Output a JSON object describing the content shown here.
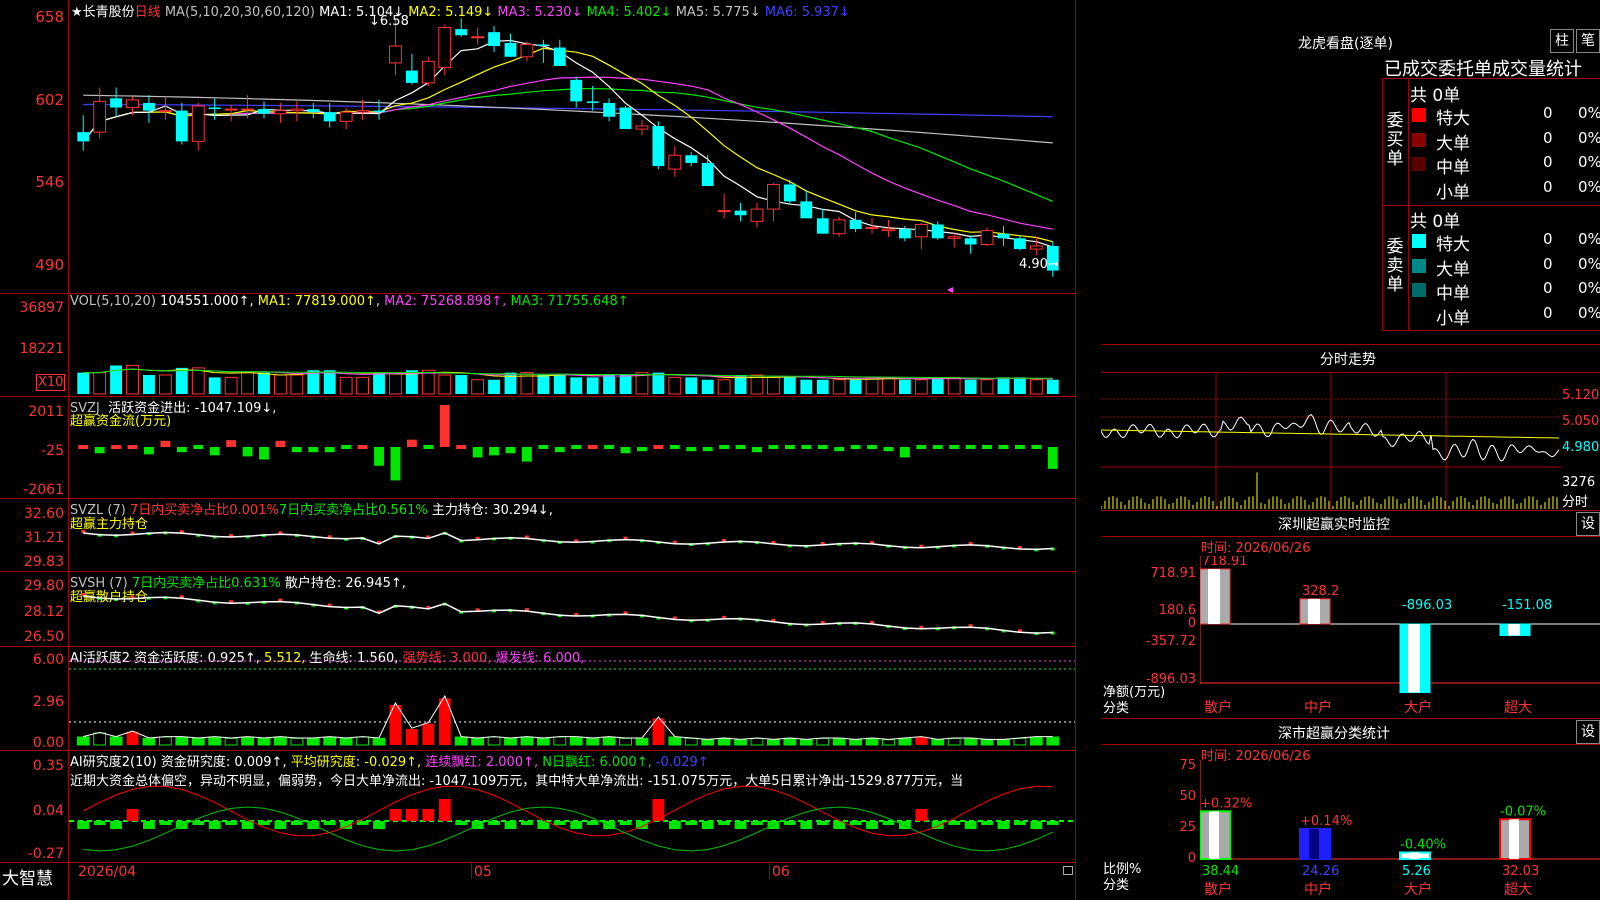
{
  "main": {
    "star": "★",
    "stock_name": "长青股份",
    "period": "日线",
    "ma_label": "MA(5,10,20,30,60,120)",
    "ma": [
      {
        "label": "MA1:",
        "value": "5.104↓",
        "color": "#ffffff"
      },
      {
        "label": "MA2:",
        "value": "5.149↓",
        "color": "#ffff00"
      },
      {
        "label": "MA3:",
        "value": "5.230↓",
        "color": "#ff40ff"
      },
      {
        "label": "MA4:",
        "value": "5.402↓",
        "color": "#00e600"
      },
      {
        "label": "MA5:",
        "value": "5.775↓",
        "color": "#c0c0c0"
      },
      {
        "label": "MA6:",
        "value": "5.937↓",
        "color": "#4040ff"
      }
    ],
    "y_ticks": [
      "658",
      "602",
      "546",
      "490"
    ],
    "high_label": "6.58",
    "low_label": "4.90",
    "colors": {
      "up": "#ff3232",
      "down": "#00ffff",
      "ma1": "#ffffff",
      "ma2": "#ffff00",
      "ma3": "#ff40ff",
      "ma4": "#00e600",
      "ma5": "#c0c0c0",
      "ma6": "#4040ff"
    }
  },
  "vol": {
    "label": "VOL(5,10,20)",
    "value": "104551.000↑,",
    "ma1": "MA1: 77819.000↑,",
    "ma2": "MA2: 75268.898↑,",
    "ma3": "MA3: 71755.648↑",
    "y_ticks": [
      "36897",
      "18221"
    ],
    "unit": "X10"
  },
  "svzj": {
    "name": "SVZJ",
    "text": "活跃资金进出: -1047.109↓,",
    "subtitle": "超赢资金流(万元)",
    "y_ticks": [
      "2011",
      "-25",
      "-2061"
    ]
  },
  "svzl": {
    "name": "SVZL (7)",
    "t1": "7日内买卖净占比0.001%",
    "t2": "7日内买卖净占比0.561%",
    "t3": "主力持仓: 30.294↓,",
    "subtitle": "超赢主力持仓",
    "y_ticks": [
      "32.60",
      "31.21",
      "29.83"
    ]
  },
  "svsh": {
    "name": "SVSH (7)",
    "t1": "7日内买卖净占比0.631%",
    "t2": "散户持仓: 26.945↑,",
    "subtitle": "超赢散户持仓",
    "y_ticks": [
      "29.80",
      "28.12",
      "26.50"
    ]
  },
  "ai_active": {
    "name": "AI活跃度2",
    "t1": "资金活跃度: 0.925↑,",
    "t2": "5.512,",
    "t3": "生命线: 1.560,",
    "t4": "强势线: 3.000,",
    "t5": "爆发线: 6.000,",
    "y_ticks": [
      "6.00",
      "2.96",
      "0.00"
    ]
  },
  "ai_research": {
    "name": "AI研究度2(10)",
    "t1": "资金研究度: 0.009↑,",
    "t2": "平均研究度: -0.029↑,",
    "t3": "连续飘红: 2.000↑,",
    "t4": "N日飘红: 6.000↑,",
    "t5": "-0.029↑",
    "commentary": "近期大资金总体偏空，异动不明显，偏弱势，今日大单净流出: -1047.109万元，其中特大单净流出: -151.075万元，大单5日累计净出-1529.877万元，当",
    "y_ticks": [
      "0.35",
      "0.04",
      "-0.27"
    ]
  },
  "x_axis": {
    "labels": [
      "2026/04",
      "05",
      "06"
    ]
  },
  "brand": "大智慧",
  "longhu": {
    "title": "龙虎看盘(逐单)",
    "btn1": "柱",
    "btn2": "笔",
    "stat_title": "已成交委托单成交量统计",
    "buy_label": "委买单",
    "sell_label": "委卖单",
    "buy_total": "共 0单",
    "sell_total": "共 0单",
    "buy_rows": [
      {
        "name": "特大",
        "count": "0",
        "pct": "0%",
        "color": "#ff0000"
      },
      {
        "name": "大单",
        "count": "0",
        "pct": "0%",
        "color": "#8b0000"
      },
      {
        "name": "中单",
        "count": "0",
        "pct": "0%",
        "color": "#5a0000"
      },
      {
        "name": "小单",
        "count": "0",
        "pct": "0%",
        "color": ""
      }
    ],
    "sell_rows": [
      {
        "name": "特大",
        "count": "0",
        "pct": "0%",
        "color": "#00ffff"
      },
      {
        "name": "大单",
        "count": "0",
        "pct": "0%",
        "color": "#008b8b"
      },
      {
        "name": "中单",
        "count": "0",
        "pct": "0%",
        "color": "#006b6b"
      },
      {
        "name": "小单",
        "count": "0",
        "pct": "0%",
        "color": ""
      }
    ]
  },
  "intraday": {
    "title": "分时走势",
    "y_ticks": [
      "5.120",
      "5.050",
      "4.980"
    ],
    "vol_tick": "3276",
    "vol_label": "分时"
  },
  "sz_monitor": {
    "title": "深圳超赢实时监控",
    "btn": "设",
    "time_label": "时间:",
    "time": "2026/06/26",
    "y_ticks": [
      "718.91",
      "180.6",
      "0",
      "-357.72",
      "-896.03"
    ],
    "ylabel": "净额(万元)",
    "xlabel": "分类",
    "categories": [
      "散户",
      "中户",
      "大户",
      "超大"
    ],
    "values": [
      718.91,
      328.2,
      -896.03,
      -151.08
    ],
    "value_labels": [
      "718.91",
      "328.2",
      "-896.03",
      "-151.08"
    ]
  },
  "sz_class": {
    "title": "深市超赢分类统计",
    "btn": "设",
    "time_label": "时间:",
    "time": "2026/06/26",
    "y_ticks": [
      "75",
      "50",
      "25",
      "0"
    ],
    "ylabel": "比例%",
    "xlabel": "分类",
    "categories": [
      "散户",
      "中户",
      "大户",
      "超大"
    ],
    "values": [
      38.44,
      24.26,
      5.26,
      32.03
    ],
    "value_labels": [
      "38.44",
      "24.26",
      "5.26",
      "32.03"
    ],
    "change_labels": [
      "+0.32%",
      "+0.14%",
      "-0.40%",
      "-0.07%"
    ]
  },
  "chart_data": [
    {
      "type": "candlestick",
      "title": "长青股份 日线",
      "ylim": [
        4.84,
        6.66
      ],
      "x_labels": [
        "2026/04",
        "05",
        "06"
      ],
      "ohlc": [
        [
          5.84,
          5.95,
          5.72,
          5.78
        ],
        [
          5.84,
          6.13,
          5.8,
          6.04
        ],
        [
          6.06,
          6.13,
          5.94,
          6.0
        ],
        [
          6.0,
          6.07,
          5.95,
          6.05
        ],
        [
          6.03,
          6.08,
          5.9,
          5.98
        ],
        [
          5.98,
          6.07,
          5.92,
          5.98
        ],
        [
          5.98,
          6.03,
          5.76,
          5.78
        ],
        [
          5.78,
          6.03,
          5.72,
          6.01
        ],
        [
          6.0,
          6.06,
          5.92,
          5.99
        ],
        [
          5.99,
          6.02,
          5.91,
          5.99
        ],
        [
          5.99,
          6.08,
          5.93,
          5.99
        ],
        [
          5.99,
          6.04,
          5.93,
          5.96
        ],
        [
          5.96,
          6.03,
          5.9,
          5.98
        ],
        [
          5.98,
          6.04,
          5.91,
          5.99
        ],
        [
          5.99,
          6.03,
          5.93,
          5.97
        ],
        [
          5.97,
          6.03,
          5.87,
          5.91
        ],
        [
          5.91,
          6.0,
          5.86,
          5.97
        ],
        [
          5.97,
          6.05,
          5.92,
          5.98
        ],
        [
          5.98,
          6.05,
          5.92,
          5.97
        ],
        [
          6.29,
          6.58,
          6.21,
          6.4
        ],
        [
          6.24,
          6.35,
          6.15,
          6.16
        ],
        [
          6.16,
          6.33,
          6.14,
          6.3
        ],
        [
          6.26,
          6.54,
          6.21,
          6.52
        ],
        [
          6.51,
          6.58,
          6.46,
          6.47
        ],
        [
          6.46,
          6.52,
          6.41,
          6.46
        ],
        [
          6.49,
          6.53,
          6.36,
          6.4
        ],
        [
          6.42,
          6.48,
          6.33,
          6.33
        ],
        [
          6.33,
          6.43,
          6.3,
          6.41
        ],
        [
          6.41,
          6.44,
          6.29,
          6.4
        ],
        [
          6.39,
          6.44,
          6.27,
          6.27
        ],
        [
          6.18,
          6.2,
          6.0,
          6.04
        ],
        [
          6.04,
          6.14,
          5.98,
          6.03
        ],
        [
          6.03,
          6.06,
          5.91,
          5.94
        ],
        [
          6.0,
          6.01,
          5.86,
          5.86
        ],
        [
          5.86,
          5.92,
          5.82,
          5.88
        ],
        [
          5.88,
          5.91,
          5.6,
          5.62
        ],
        [
          5.6,
          5.75,
          5.55,
          5.69
        ],
        [
          5.69,
          5.71,
          5.62,
          5.64
        ],
        [
          5.64,
          5.69,
          5.49,
          5.49
        ],
        [
          5.33,
          5.44,
          5.28,
          5.33
        ],
        [
          5.33,
          5.38,
          5.26,
          5.3
        ],
        [
          5.26,
          5.38,
          5.22,
          5.34
        ],
        [
          5.34,
          5.51,
          5.26,
          5.5
        ],
        [
          5.5,
          5.53,
          5.37,
          5.39
        ],
        [
          5.39,
          5.46,
          5.29,
          5.28
        ],
        [
          5.28,
          5.34,
          5.18,
          5.18
        ],
        [
          5.18,
          5.29,
          5.16,
          5.27
        ],
        [
          5.27,
          5.32,
          5.19,
          5.21
        ],
        [
          5.22,
          5.28,
          5.18,
          5.22
        ],
        [
          5.2,
          5.27,
          5.16,
          5.21
        ],
        [
          5.21,
          5.23,
          5.13,
          5.15
        ],
        [
          5.16,
          5.25,
          5.08,
          5.24
        ],
        [
          5.24,
          5.26,
          5.14,
          5.15
        ],
        [
          5.15,
          5.19,
          5.09,
          5.16
        ],
        [
          5.15,
          5.17,
          5.05,
          5.11
        ],
        [
          5.11,
          5.22,
          5.1,
          5.2
        ],
        [
          5.18,
          5.23,
          5.1,
          5.15
        ],
        [
          5.15,
          5.17,
          5.07,
          5.08
        ],
        [
          5.08,
          5.16,
          5.04,
          5.1
        ],
        [
          5.1,
          5.13,
          4.9,
          4.94
        ]
      ]
    },
    {
      "type": "bar",
      "title": "VOL(5,10,20)",
      "ylim": [
        0,
        36897
      ],
      "series": [
        {
          "values": [
            9,
            9,
            12,
            12,
            8,
            8,
            11,
            11,
            7,
            7,
            9,
            9,
            8,
            8,
            10,
            10,
            7,
            7,
            9,
            9,
            10,
            10,
            8,
            8,
            6,
            6,
            9,
            9,
            8,
            8,
            7,
            7,
            8,
            8,
            9,
            9,
            7,
            7,
            6,
            6,
            8,
            8,
            7,
            7,
            6,
            6,
            6,
            6,
            7,
            7,
            6,
            6,
            7,
            7,
            6,
            6,
            7,
            7,
            6,
            6
          ]
        }
      ]
    },
    {
      "type": "bar",
      "title": "SVZJ 活跃资金进出",
      "ylim": [
        -2061,
        2011
      ],
      "values": [
        0,
        -300,
        150,
        120,
        -350,
        300,
        -250,
        -150,
        -400,
        330,
        -450,
        -600,
        300,
        -250,
        -250,
        -250,
        -180,
        150,
        -900,
        -1600,
        350,
        -100,
        2011,
        180,
        -500,
        -400,
        -300,
        -700,
        -120,
        -250,
        -120,
        80,
        -150,
        -300,
        -200,
        150,
        -150,
        -200,
        -200,
        -150,
        -100,
        -250,
        -150,
        -100,
        -100,
        -100,
        -200,
        -100,
        -180,
        -200,
        -500,
        -100,
        -100,
        -150,
        -100,
        -100,
        -120,
        -100,
        -150,
        -1047
      ]
    }
  ]
}
